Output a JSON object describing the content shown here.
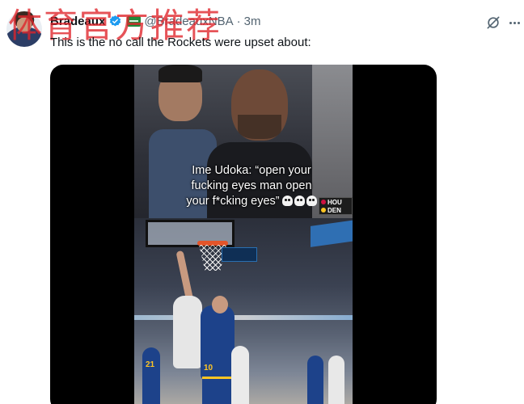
{
  "tweet": {
    "author_name": "Bradeaux",
    "author_handle": "@BradeauxNBA",
    "separator": "·",
    "time": "3m",
    "text": "This is the no call the Rockets were upset about:"
  },
  "watermark": {
    "text": "体育官方推荐"
  },
  "icons": {
    "avatar": "avatar",
    "verified": "verified-badge-icon",
    "affiliate": "affiliate-badge-icon",
    "grok": "grok-icon",
    "more": "more-options-icon"
  },
  "media": {
    "caption_lines": [
      "Ime Udoka: “open your",
      "fucking eyes man open",
      "your f*cking eyes”"
    ],
    "scorebug": {
      "team1": "HOU",
      "team2": "DEN"
    },
    "jersey_numbers": {
      "player_bottom_left": "21",
      "player_center": "10"
    }
  },
  "colors": {
    "text_primary": "#0f1419",
    "text_secondary": "#536471",
    "verified_blue": "#1d9bf0",
    "watermark_red": "#e0242a"
  }
}
